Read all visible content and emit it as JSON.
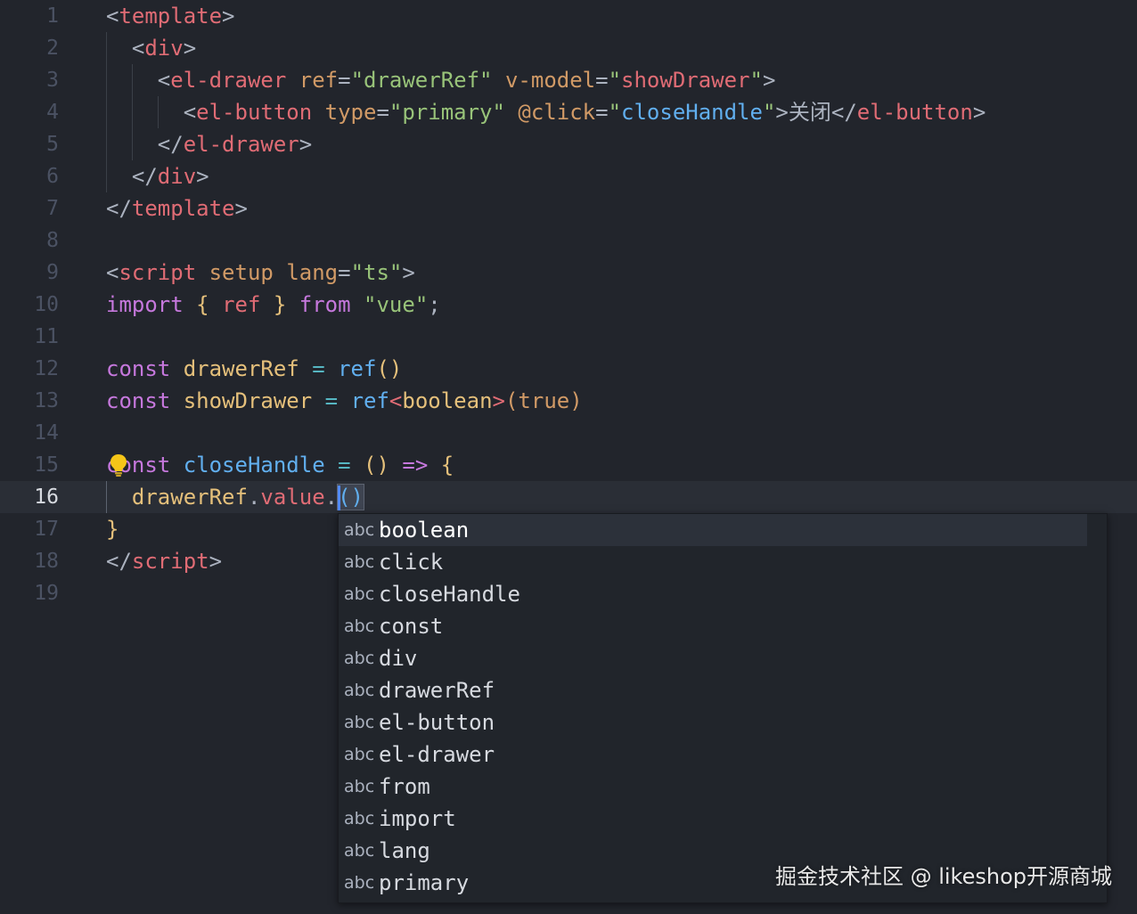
{
  "editor": {
    "current_line": 16,
    "lines": [
      {
        "n": "1",
        "tokens": [
          [
            "c-p",
            "<"
          ],
          [
            "c-tag",
            "template"
          ],
          [
            "c-p",
            ">"
          ]
        ]
      },
      {
        "n": "2",
        "tokens": [
          [
            "c-p",
            "  <"
          ],
          [
            "c-tag",
            "div"
          ],
          [
            "c-p",
            ">"
          ]
        ]
      },
      {
        "n": "3",
        "tokens": [
          [
            "c-p",
            "    <"
          ],
          [
            "c-tag",
            "el-drawer"
          ],
          [
            "c-p",
            " "
          ],
          [
            "c-attr",
            "ref"
          ],
          [
            "c-p",
            "="
          ],
          [
            "c-str",
            "\"drawerRef\""
          ],
          [
            "c-p",
            " "
          ],
          [
            "c-attr",
            "v-model"
          ],
          [
            "c-p",
            "="
          ],
          [
            "c-str",
            "\""
          ],
          [
            "c-tag",
            "showDrawer"
          ],
          [
            "c-str",
            "\""
          ],
          [
            "c-p",
            ">"
          ]
        ]
      },
      {
        "n": "4",
        "tokens": [
          [
            "c-p",
            "      <"
          ],
          [
            "c-tag",
            "el-button"
          ],
          [
            "c-p",
            " "
          ],
          [
            "c-attr",
            "type"
          ],
          [
            "c-p",
            "="
          ],
          [
            "c-str",
            "\"primary\""
          ],
          [
            "c-p",
            " "
          ],
          [
            "c-attr",
            "@click"
          ],
          [
            "c-p",
            "="
          ],
          [
            "c-str",
            "\""
          ],
          [
            "c-fn",
            "closeHandle"
          ],
          [
            "c-str",
            "\""
          ],
          [
            "c-p",
            ">"
          ],
          [
            "c-txt",
            "关闭"
          ],
          [
            "c-p",
            "</"
          ],
          [
            "c-tag",
            "el-button"
          ],
          [
            "c-p",
            ">"
          ]
        ]
      },
      {
        "n": "5",
        "tokens": [
          [
            "c-p",
            "    </"
          ],
          [
            "c-tag",
            "el-drawer"
          ],
          [
            "c-p",
            ">"
          ]
        ]
      },
      {
        "n": "6",
        "tokens": [
          [
            "c-p",
            "  </"
          ],
          [
            "c-tag",
            "div"
          ],
          [
            "c-p",
            ">"
          ]
        ]
      },
      {
        "n": "7",
        "tokens": [
          [
            "c-p",
            "</"
          ],
          [
            "c-tag",
            "template"
          ],
          [
            "c-p",
            ">"
          ]
        ]
      },
      {
        "n": "8",
        "tokens": []
      },
      {
        "n": "9",
        "tokens": [
          [
            "c-p",
            "<"
          ],
          [
            "c-tag",
            "script"
          ],
          [
            "c-p",
            " "
          ],
          [
            "c-attr",
            "setup"
          ],
          [
            "c-p",
            " "
          ],
          [
            "c-attr",
            "lang"
          ],
          [
            "c-p",
            "="
          ],
          [
            "c-str",
            "\"ts\""
          ],
          [
            "c-p",
            ">"
          ]
        ]
      },
      {
        "n": "10",
        "tokens": [
          [
            "c-kw",
            "import"
          ],
          [
            "c-p",
            " "
          ],
          [
            "c-var",
            "{"
          ],
          [
            "c-p",
            " "
          ],
          [
            "c-tag",
            "ref"
          ],
          [
            "c-p",
            " "
          ],
          [
            "c-var",
            "}"
          ],
          [
            "c-p",
            " "
          ],
          [
            "c-kw",
            "from"
          ],
          [
            "c-p",
            " "
          ],
          [
            "c-str",
            "\"vue\""
          ],
          [
            "c-p",
            ";"
          ]
        ]
      },
      {
        "n": "11",
        "tokens": []
      },
      {
        "n": "12",
        "tokens": [
          [
            "c-kw",
            "const"
          ],
          [
            "c-p",
            " "
          ],
          [
            "c-var",
            "drawerRef"
          ],
          [
            "c-p",
            " "
          ],
          [
            "c-op",
            "="
          ],
          [
            "c-p",
            " "
          ],
          [
            "c-fn",
            "ref"
          ],
          [
            "c-var",
            "()"
          ]
        ]
      },
      {
        "n": "13",
        "tokens": [
          [
            "c-kw",
            "const"
          ],
          [
            "c-p",
            " "
          ],
          [
            "c-var",
            "showDrawer"
          ],
          [
            "c-p",
            " "
          ],
          [
            "c-op",
            "="
          ],
          [
            "c-p",
            " "
          ],
          [
            "c-fn",
            "ref"
          ],
          [
            "c-tag",
            "<"
          ],
          [
            "c-var",
            "boolean"
          ],
          [
            "c-tag",
            ">"
          ],
          [
            "c-attr",
            "(true)"
          ]
        ]
      },
      {
        "n": "14",
        "tokens": []
      },
      {
        "n": "15",
        "tokens": [
          [
            "c-kw",
            "const"
          ],
          [
            "c-p",
            " "
          ],
          [
            "c-fn",
            "closeHandle"
          ],
          [
            "c-p",
            " "
          ],
          [
            "c-op",
            "="
          ],
          [
            "c-p",
            " "
          ],
          [
            "c-var",
            "()"
          ],
          [
            "c-p",
            " "
          ],
          [
            "c-kw",
            "=>"
          ],
          [
            "c-p",
            " "
          ],
          [
            "c-var",
            "{"
          ]
        ]
      },
      {
        "n": "16",
        "tokens": [
          [
            "c-p",
            "  "
          ],
          [
            "c-var",
            "drawerRef"
          ],
          [
            "c-p",
            "."
          ],
          [
            "c-tag",
            "value"
          ],
          [
            "c-p",
            "."
          ]
        ]
      },
      {
        "n": "17",
        "tokens": [
          [
            "c-var",
            "}"
          ]
        ]
      },
      {
        "n": "18",
        "tokens": [
          [
            "c-p",
            "</"
          ],
          [
            "c-tag",
            "script"
          ],
          [
            "c-p",
            ">"
          ]
        ]
      },
      {
        "n": "19",
        "tokens": []
      }
    ],
    "cursor_after_tokens": [
      [
        "c-fn",
        "()"
      ]
    ]
  },
  "suggest": {
    "selected_index": 0,
    "items": [
      {
        "kind": "abc",
        "label": "boolean"
      },
      {
        "kind": "abc",
        "label": "click"
      },
      {
        "kind": "abc",
        "label": "closeHandle"
      },
      {
        "kind": "abc",
        "label": "const"
      },
      {
        "kind": "abc",
        "label": "div"
      },
      {
        "kind": "abc",
        "label": "drawerRef"
      },
      {
        "kind": "abc",
        "label": "el-button"
      },
      {
        "kind": "abc",
        "label": "el-drawer"
      },
      {
        "kind": "abc",
        "label": "from"
      },
      {
        "kind": "abc",
        "label": "import"
      },
      {
        "kind": "abc",
        "label": "lang"
      },
      {
        "kind": "abc",
        "label": "primary"
      }
    ]
  },
  "watermark": "掘金技术社区 @ likeshop开源商城",
  "colors": {
    "background": "#22252c",
    "current_line": "#2a2e36",
    "cursor": "#528bff",
    "lightbulb": "#f5c518"
  },
  "icons": {
    "lightbulb": "lightbulb-icon"
  }
}
